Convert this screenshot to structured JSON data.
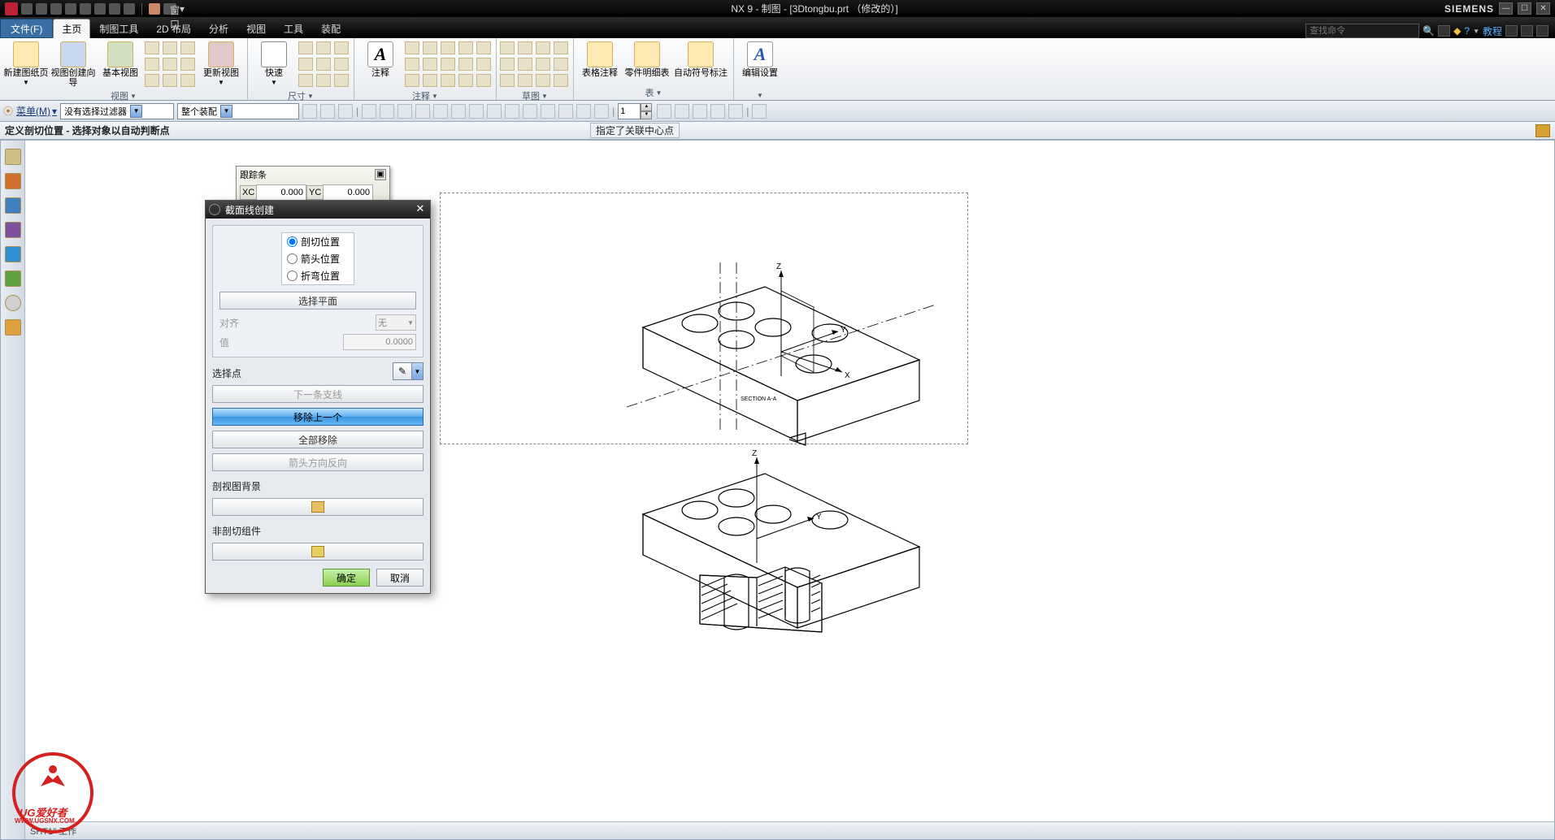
{
  "app": {
    "title": "NX 9 - 制图 - [3Dtongbu.prt （修改的）]",
    "brand": "SIEMENS",
    "window_menu": "窗口",
    "cmd_search_placeholder": "查找命令",
    "tutorial": "教程"
  },
  "menu": {
    "file": "文件(F)",
    "tabs": [
      "主页",
      "制图工具",
      "2D 布局",
      "分析",
      "视图",
      "工具",
      "装配"
    ],
    "active": 0
  },
  "ribbon": {
    "groups": [
      {
        "id": "view",
        "label": "视图",
        "big": [
          {
            "id": "new-sheet",
            "label": "新建图纸页"
          },
          {
            "id": "view-wizard",
            "label": "视图创建向导"
          },
          {
            "id": "base-view",
            "label": "基本视图"
          },
          {
            "id": "update-view",
            "label": "更新视图"
          }
        ]
      },
      {
        "id": "dim",
        "label": "尺寸",
        "big": [
          {
            "id": "quick",
            "label": "快速"
          }
        ]
      },
      {
        "id": "annot",
        "label": "注释",
        "big": [
          {
            "id": "note",
            "label": "注释"
          }
        ]
      },
      {
        "id": "sketch",
        "label": "草图"
      },
      {
        "id": "table",
        "label": "表",
        "big": [
          {
            "id": "tab-note",
            "label": "表格注释"
          },
          {
            "id": "parts-list",
            "label": "零件明细表"
          },
          {
            "id": "auto-balloon",
            "label": "自动符号标注"
          }
        ]
      },
      {
        "id": "edit",
        "label": "",
        "big": [
          {
            "id": "edit-settings",
            "label": "编辑设置"
          }
        ]
      }
    ]
  },
  "options": {
    "menu_btn": "菜单(M)",
    "filter_combo": "没有选择过滤器",
    "assembly_combo": "整个装配",
    "spin_value": "1"
  },
  "prompt": {
    "left": "定义剖切位置 - 选择对象以自动判断点",
    "right": "指定了关联中心点"
  },
  "tracking": {
    "title": "跟踪条",
    "xc_label": "XC",
    "xc_value": "0.000",
    "yc_label": "YC",
    "yc_value": "0.000"
  },
  "dialog": {
    "title": "截面线创建",
    "radios": [
      "剖切位置",
      "箭头位置",
      "折弯位置"
    ],
    "radio_selected": 0,
    "select_plane": "选择平面",
    "align_label": "对齐",
    "align_value": "无",
    "value_label": "值",
    "value_value": "0.0000",
    "select_point": "选择点",
    "next_spline": "下一条支线",
    "remove_last": "移除上一个",
    "remove_all": "全部移除",
    "reverse_arrow": "箭头方向反向",
    "section_bg": "剖视图背景",
    "non_section": "非剖切组件",
    "ok": "确定",
    "cancel": "取消"
  },
  "drawing": {
    "axes": {
      "x": "X",
      "y": "Y",
      "z": "Z"
    },
    "section_label": "SECTION A-A"
  },
  "status": {
    "text": "SHT1\" 工作"
  },
  "watermark": {
    "line1": "UG爱好者",
    "line2": "WWW.UGSNX.COM"
  }
}
